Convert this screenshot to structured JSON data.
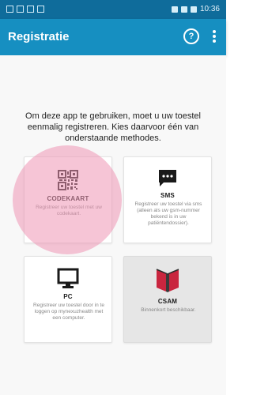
{
  "status_bar": {
    "time": "10:36"
  },
  "app_bar": {
    "title": "Registratie",
    "help_symbol": "?"
  },
  "intro": "Om deze app te gebruiken, moet u uw toestel eenmalig registreren. Kies daarvoor één van onderstaande methodes.",
  "methods": [
    {
      "title": "CODEKAART",
      "description": "Registreer uw toestel met uw codekaart.",
      "icon": "qr-code-icon"
    },
    {
      "title": "SMS",
      "description": "Registreer uw toestel via sms (alleen als uw gsm-nummer bekend is in uw patiëntendossier).",
      "icon": "chat-bubble-icon"
    },
    {
      "title": "PC",
      "description": "Registreer uw toestel door in te loggen op mynexuzhealth met een computer.",
      "icon": "monitor-icon"
    },
    {
      "title": "CSAM",
      "description": "Binnenkort beschikbaar.",
      "icon": "csam-icon"
    }
  ],
  "colors": {
    "app_bar": "#168fc1",
    "status_bar": "#0f6c9b",
    "highlight": "#ee96b4"
  }
}
